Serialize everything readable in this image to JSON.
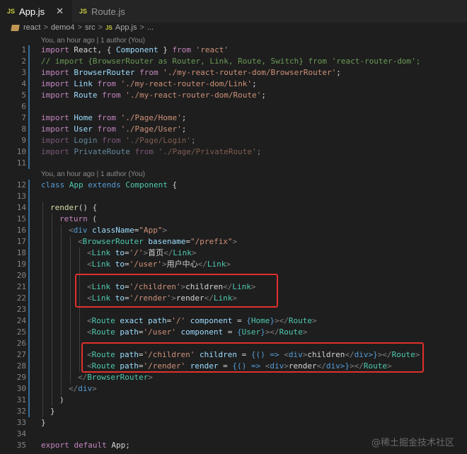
{
  "tabs": [
    {
      "icon": "JS",
      "label": "App.js",
      "close": "✕"
    },
    {
      "icon": "JS",
      "label": "Route.js"
    }
  ],
  "breadcrumb": {
    "items": [
      "react",
      "demo4",
      "src"
    ],
    "file_icon": "JS",
    "file": "App.js",
    "separator": ">",
    "trail": "..."
  },
  "blame": [
    "You, an hour ago | 1 author (You)",
    "You, an hour ago | 1 author (You)"
  ],
  "line_numbers": [
    "1",
    "2",
    "3",
    "4",
    "5",
    "6",
    "7",
    "8",
    "9",
    "10",
    "11",
    "12",
    "13",
    "14",
    "15",
    "16",
    "17",
    "18",
    "19",
    "20",
    "21",
    "22",
    "23",
    "24",
    "25",
    "26",
    "27",
    "28",
    "29",
    "30",
    "31",
    "32",
    "33",
    "34",
    "35"
  ],
  "code": {
    "l1": {
      "a": "import",
      "b": " React, { ",
      "c": "Component",
      "d": " } ",
      "e": "from",
      "f": " ",
      "g": "'react'"
    },
    "l2": "// import {BrowserRouter as Router, Link, Route, Switch} from 'react-router-dom';",
    "l3": {
      "a": "import",
      "b": " BrowserRouter ",
      "c": "from",
      "d": " ",
      "e": "'./my-react-router-dom/BrowserRouter'",
      "f": ";"
    },
    "l4": {
      "a": "import",
      "b": " Link ",
      "c": "from",
      "d": " ",
      "e": "'./my-react-router-dom/Link'",
      "f": ";"
    },
    "l5": {
      "a": "import",
      "b": " Route ",
      "c": "from",
      "d": " ",
      "e": "'./my-react-router-dom/Route'",
      "f": ";"
    },
    "l7": {
      "a": "import",
      "b": " Home ",
      "c": "from",
      "d": " ",
      "e": "'./Page/Home'",
      "f": ";"
    },
    "l8": {
      "a": "import",
      "b": " User ",
      "c": "from",
      "d": " ",
      "e": "'./Page/User'",
      "f": ";"
    },
    "l9": {
      "a": "import",
      "b": " Login ",
      "c": "from",
      "d": " ",
      "e": "'./Page/Login'",
      "f": ";"
    },
    "l10": {
      "a": "import",
      "b": " PrivateRoute ",
      "c": "from",
      "d": " ",
      "e": "'./Page/PrivateRoute'",
      "f": ";"
    },
    "l12": {
      "a": "class",
      "b": " App ",
      "c": "extends",
      "d": " ",
      "e": "Component",
      "f": " {"
    },
    "l14": {
      "a": "render",
      "b": "() {"
    },
    "l15": {
      "a": "return",
      "b": " ("
    },
    "l16": {
      "a": "<",
      "b": "div",
      "c": " className",
      "d": "=",
      "e": "\"App\"",
      "f": ">"
    },
    "l17": {
      "a": "<",
      "b": "BrowserRouter",
      "c": " basename",
      "d": "=",
      "e": "\"/prefix\"",
      "f": ">"
    },
    "l18": {
      "a": "<",
      "b": "Link",
      "c": " to",
      "d": "=",
      "e": "'/'",
      "f": ">",
      "g": "首页",
      "h": "</",
      "i": "Link",
      "j": ">"
    },
    "l19": {
      "a": "<",
      "b": "Link",
      "c": " to",
      "d": "=",
      "e": "'/user'",
      "f": ">",
      "g": "用户中心",
      "h": "</",
      "i": "Link",
      "j": ">"
    },
    "l21": {
      "a": "<",
      "b": "Link",
      "c": " to",
      "d": "=",
      "e": "'/children'",
      "f": ">",
      "g": "children",
      "h": "</",
      "i": "Link",
      "j": ">"
    },
    "l22": {
      "a": "<",
      "b": "Link",
      "c": " to",
      "d": "=",
      "e": "'/render'",
      "f": ">",
      "g": "render",
      "h": "</",
      "i": "Link",
      "j": ">"
    },
    "l24": {
      "a": "<",
      "b": "Route",
      "c": " exact path",
      "d": "=",
      "e": "'/'",
      "f": " component ",
      "g": "=",
      "h": " {",
      "i": "Home",
      "j": "}",
      "k": "></",
      "l": "Route",
      "m": ">"
    },
    "l25": {
      "a": "<",
      "b": "Route",
      "c": " path",
      "d": "=",
      "e": "'/user'",
      "f": " component ",
      "g": "=",
      "h": " {",
      "i": "User",
      "j": "}",
      "k": "></",
      "l": "Route",
      "m": ">"
    },
    "l27": {
      "a": "<",
      "b": "Route",
      "c": " path",
      "d": "=",
      "e": "'/children'",
      "f": " children ",
      "g": "=",
      "h": " {",
      "i": "() =>",
      "j": " <",
      "k": "div",
      "l": ">",
      "m": "children",
      "n": "</",
      "o": "div",
      "p": ">}",
      "q": "></",
      "r": "Route",
      "s": ">"
    },
    "l28": {
      "a": "<",
      "b": "Route",
      "c": " path",
      "d": "=",
      "e": "'/render'",
      "f": " render ",
      "g": "=",
      "h": " {",
      "i": "() =>",
      "j": " <",
      "k": "div",
      "l": ">",
      "m": "render",
      "n": "</",
      "o": "div",
      "p": ">}",
      "q": "></",
      "r": "Route",
      "s": ">"
    },
    "l29": {
      "a": "</",
      "b": "BrowserRouter",
      "c": ">"
    },
    "l30": {
      "a": "</",
      "b": "div",
      "c": ">"
    },
    "l31": ")",
    "l32": "}",
    "l33": "}",
    "l35": {
      "a": "export",
      "b": " ",
      "c": "default",
      "d": " App;"
    }
  },
  "watermark": "@稀土掘金技术社区",
  "colors": {
    "highlight_box": "#e0302c",
    "git_gutter": "#2f6f9f"
  }
}
